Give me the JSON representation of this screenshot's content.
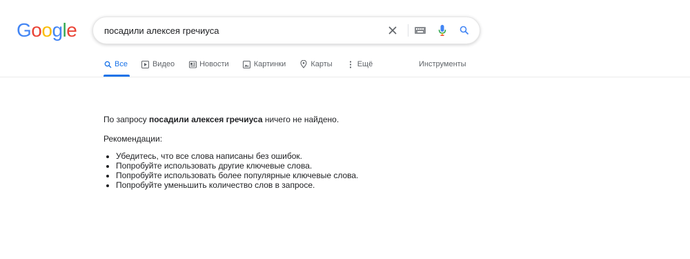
{
  "logo": {
    "letters": [
      "G",
      "o",
      "o",
      "g",
      "l",
      "e"
    ]
  },
  "search": {
    "query": "посадили алексея гречиуса",
    "icons": [
      "clear-icon",
      "keyboard-icon",
      "microphone-icon",
      "search-icon"
    ]
  },
  "tabs": [
    {
      "label": "Все",
      "icon": "search-icon",
      "active": true
    },
    {
      "label": "Видео",
      "icon": "video-icon"
    },
    {
      "label": "Новости",
      "icon": "news-icon"
    },
    {
      "label": "Картинки",
      "icon": "images-icon"
    },
    {
      "label": "Карты",
      "icon": "map-pin-icon"
    },
    {
      "label": "Ещё",
      "icon": "more-vert-icon"
    }
  ],
  "tools_label": "Инструменты",
  "results": {
    "prefix": "По запросу ",
    "query": "посадили алексея гречиуса",
    "suffix": " ничего не найдено.",
    "recommendations_title": "Рекомендации:",
    "recommendations": [
      "Убедитесь, что все слова написаны без ошибок.",
      "Попробуйте использовать другие ключевые слова.",
      "Попробуйте использовать более популярные ключевые слова.",
      "Попробуйте уменьшить количество слов в запросе."
    ]
  },
  "colors": {
    "accent": "#1a73e8",
    "text": "#202124",
    "muted": "#5f6368"
  }
}
